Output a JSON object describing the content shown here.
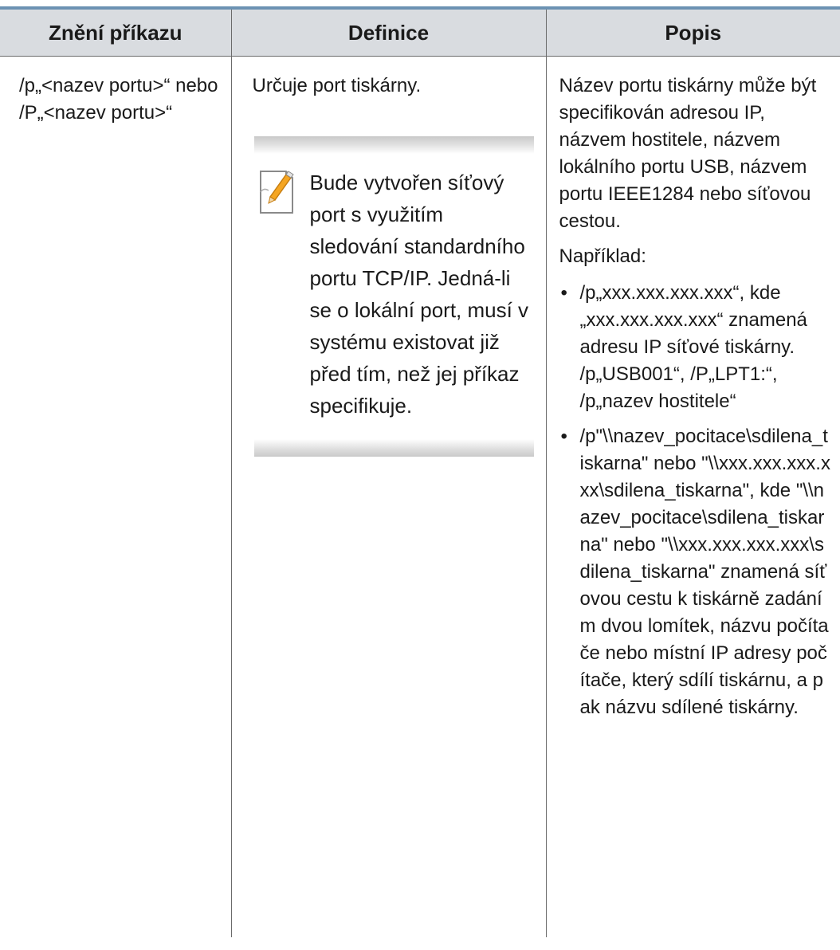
{
  "table": {
    "headers": [
      "Znění příkazu",
      "Definice",
      "Popis"
    ],
    "command": "/p„<nazev portu>“ nebo /P„<nazev portu>“",
    "definition": "Určuje port tiskárny.",
    "note": {
      "icon": "note-pencil-icon",
      "text": "Bude vytvořen síťový port s využitím sledování standardního portu TCP/IP. Jedná-li se o lokální port, musí v systému existovat již před tím, než jej příkaz specifikuje."
    },
    "description": {
      "intro": "Název portu tiskárny může být specifikován adresou IP, názvem hostitele, názvem lokálního portu USB, názvem portu IEEE1284 nebo síťovou cestou.",
      "example_label": "Například:",
      "bullets": [
        "/p„xxx.xxx.xxx.xxx“, kde „xxx.xxx.xxx.xxx“ znamená adresu IP síťové tiskárny. /p„USB001“, /P„LPT1:“, /p„nazev hostitele“",
        "/p\"\\\\nazev_pocitace\\sdilena_tiskarna\" nebo \"\\\\xxx.xxx.xxx.xxx\\sdilena_tiskarna\", kde \"\\\\nazev_pocitace\\sdilena_tiskarna\" nebo \"\\\\xxx.xxx.xxx.xxx\\sdilena_tiskarna\" znamená síťovou cestu k tiskárně zadáním dvou lomítek, názvu počítače nebo místní IP adresy počítače, který sdílí tiskárnu, a pak názvu sdílené tiskárny."
      ]
    }
  },
  "colors": {
    "top_rule": "#6c92b3",
    "header_bg": "#d9dce0",
    "border": "#6b6b6b"
  }
}
